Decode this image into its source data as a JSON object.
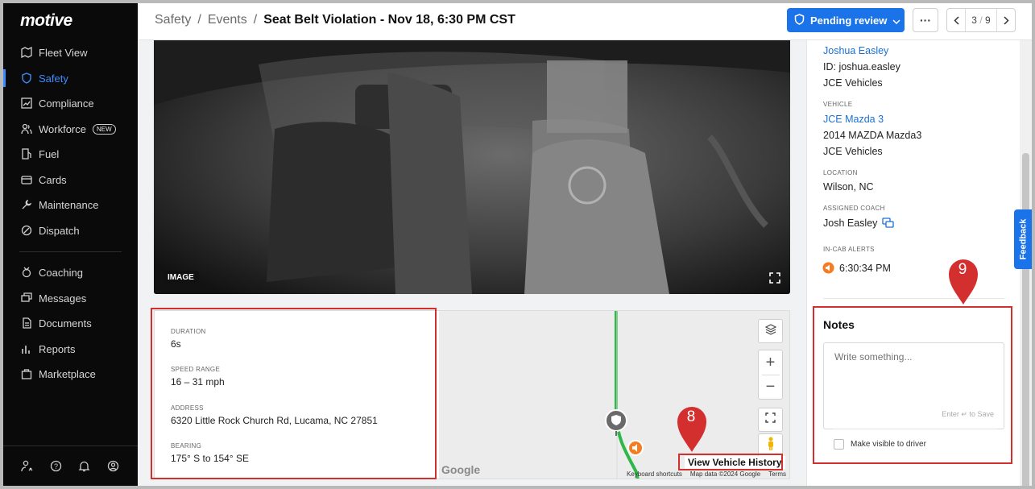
{
  "app": {
    "logo": "motive"
  },
  "sidebar": {
    "items": [
      {
        "label": "Fleet View",
        "icon": "map-icon"
      },
      {
        "label": "Safety",
        "icon": "shield-icon",
        "active": true
      },
      {
        "label": "Compliance",
        "icon": "chart-icon"
      },
      {
        "label": "Workforce",
        "icon": "people-icon",
        "badge": "NEW"
      },
      {
        "label": "Fuel",
        "icon": "fuel-icon"
      },
      {
        "label": "Cards",
        "icon": "card-icon"
      },
      {
        "label": "Maintenance",
        "icon": "wrench-icon"
      },
      {
        "label": "Dispatch",
        "icon": "dispatch-icon"
      },
      {
        "label": "Coaching",
        "icon": "coaching-icon"
      },
      {
        "label": "Messages",
        "icon": "messages-icon"
      },
      {
        "label": "Documents",
        "icon": "document-icon"
      },
      {
        "label": "Reports",
        "icon": "reports-icon"
      },
      {
        "label": "Marketplace",
        "icon": "bag-icon"
      }
    ],
    "footer_icons": [
      "user-settings-icon",
      "help-icon",
      "bell-icon",
      "account-icon"
    ]
  },
  "header": {
    "breadcrumb": [
      "Safety",
      "Events"
    ],
    "title": "Seat Belt Violation - Nov 18, 6:30 PM CST",
    "status_button": "Pending review",
    "more_label": "···",
    "pager": {
      "current": "3",
      "sep": "/",
      "total": "9"
    }
  },
  "media": {
    "badge": "IMAGE"
  },
  "event_info": {
    "duration_label": "DURATION",
    "duration": "6s",
    "speed_label": "SPEED RANGE",
    "speed": "16 – 31 mph",
    "address_label": "ADDRESS",
    "address": "6320 Little Rock Church Rd, Lucama, NC 27851",
    "bearing_label": "BEARING",
    "bearing": "175° S to 154° SE"
  },
  "map": {
    "google": "Google",
    "keyboard": "Keyboard shortcuts",
    "mapdata": "Map data ©2024 Google",
    "terms": "Terms",
    "history_link": "View Vehicle History"
  },
  "details": {
    "driver_name": "Joshua Easley",
    "driver_id": "ID: joshua.easley",
    "driver_group": "JCE Vehicles",
    "vehicle_label": "VEHICLE",
    "vehicle_name": "JCE Mazda 3",
    "vehicle_model": "2014 MAZDA Mazda3",
    "vehicle_group": "JCE Vehicles",
    "location_label": "LOCATION",
    "location": "Wilson, NC",
    "coach_label": "ASSIGNED COACH",
    "coach": "Josh Easley",
    "alerts_label": "IN-CAB ALERTS",
    "alert_time": "6:30:34 PM"
  },
  "notes": {
    "title": "Notes",
    "placeholder": "Write something...",
    "hint": "Enter ↵ to Save",
    "visible_label": "Make visible to driver"
  },
  "feedback": "Feedback",
  "annotations": {
    "pin8": "8",
    "pin9": "9"
  },
  "colors": {
    "accent": "#1a73e8",
    "highlight": "#d32f2f",
    "route": "#2eb84a",
    "alert": "#f57c22"
  }
}
